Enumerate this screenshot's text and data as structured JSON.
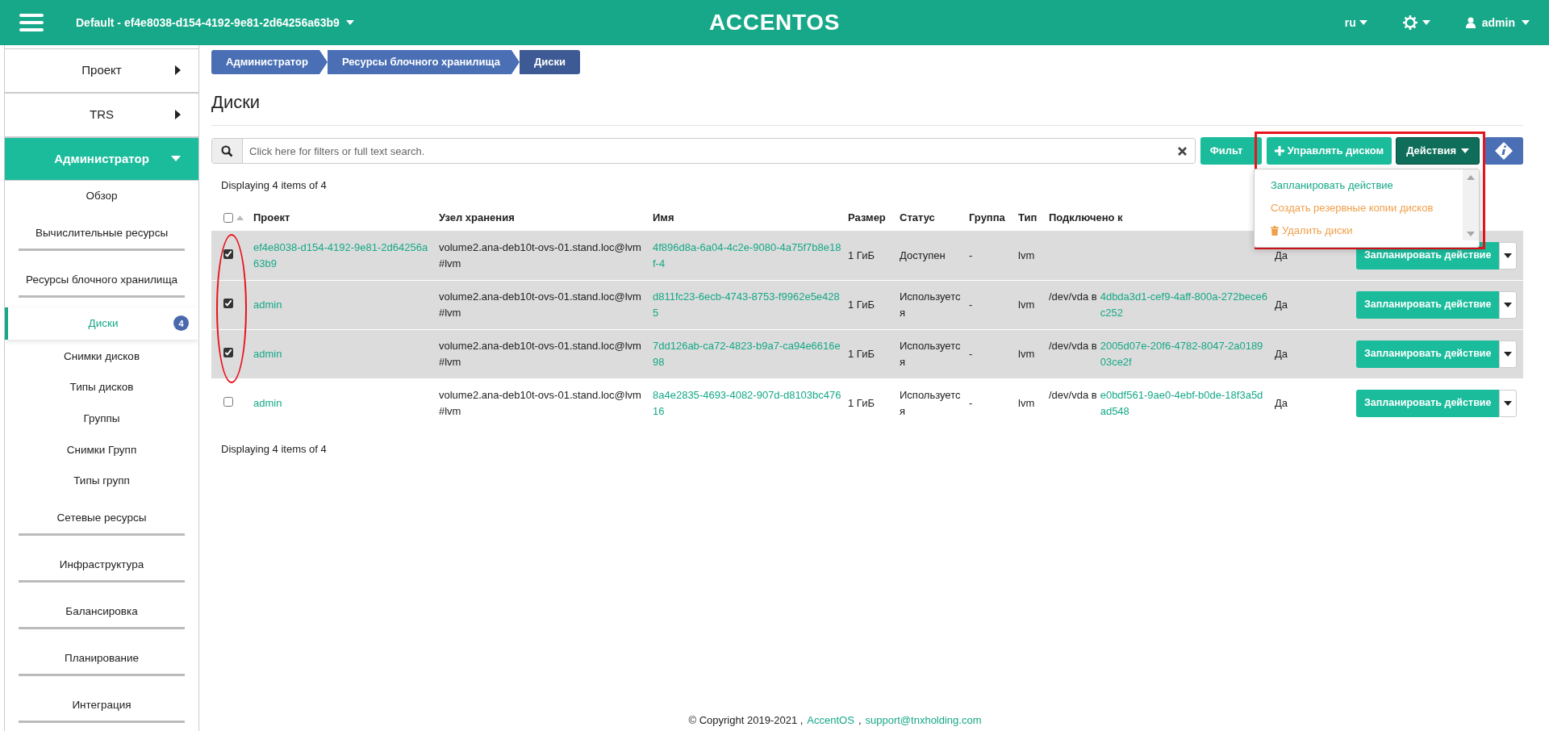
{
  "header": {
    "project": "Default - ef4e8038-d154-4192-9e81-2d64256a63b9",
    "logo": "ACCENTOS",
    "language": "ru",
    "user": "admin"
  },
  "sidebar": {
    "items": [
      {
        "label": "Проект",
        "expanded": false
      },
      {
        "label": "TRS",
        "expanded": false
      },
      {
        "label": "Администратор",
        "expanded": true,
        "children": [
          {
            "kind": "link",
            "label": "Обзор",
            "selected": false
          },
          {
            "kind": "group",
            "label": "Вычислительные ресурсы"
          },
          {
            "kind": "group",
            "label": "Ресурсы блочного хранилища"
          },
          {
            "kind": "link",
            "label": "Диски",
            "selected": true,
            "badge": "4"
          },
          {
            "kind": "link",
            "label": "Снимки дисков",
            "selected": false
          },
          {
            "kind": "link",
            "label": "Типы дисков",
            "selected": false
          },
          {
            "kind": "link",
            "label": "Группы",
            "selected": false
          },
          {
            "kind": "link",
            "label": "Снимки Групп",
            "selected": false
          },
          {
            "kind": "link",
            "label": "Типы групп",
            "selected": false
          },
          {
            "kind": "group",
            "label": "Сетевые ресурсы"
          },
          {
            "kind": "group",
            "label": "Инфраструктура"
          },
          {
            "kind": "group",
            "label": "Балансировка"
          },
          {
            "kind": "group",
            "label": "Планирование"
          },
          {
            "kind": "group",
            "label": "Интеграция"
          }
        ]
      }
    ]
  },
  "breadcrumbs": [
    {
      "label": "Администратор",
      "selected": false
    },
    {
      "label": "Ресурсы блочного хранилища",
      "selected": false
    },
    {
      "label": "Диски",
      "selected": true
    }
  ],
  "title": "Диски",
  "search": {
    "placeholder": "Click here for filters or full text search."
  },
  "buttons": {
    "filter": "Фильт",
    "manage": "Управлять диском",
    "actions": "Действия"
  },
  "actions_menu": [
    {
      "kind": "plain",
      "label": "Запланировать действие"
    },
    {
      "kind": "warning",
      "label": "Создать резервные копии дисков"
    },
    {
      "kind": "delete",
      "label": "Удалить диски"
    }
  ],
  "count_top": "Displaying 4 items of 4",
  "table": {
    "select_all_checked": false,
    "columns": [
      "Проект",
      "Узел хранения",
      "Имя",
      "Размер",
      "Статус",
      "Группа",
      "Тип",
      "Подключено к"
    ],
    "rows": [
      {
        "checked": true,
        "project": "ef4e8038-d154-4192-9e81-2d64256a63b9",
        "host": "volume2.ana-deb10t-ovs-01.stand.loc@lvm#lvm",
        "name": "4f896d8a-6a04-4c2e-9080-4a75f7b8e18f-4",
        "size": "1 ГиБ",
        "status": "Доступен",
        "group": "-",
        "type": "lvm",
        "column_9": "Да",
        "action": "Запланировать действие"
      },
      {
        "checked": true,
        "project": "admin",
        "host": "volume2.ana-deb10t-ovs-01.stand.loc@lvm#lvm",
        "name": "d811fc23-6ecb-4743-8753-f9962e5e4285",
        "size": "1 ГиБ",
        "status": "Используется",
        "group": "-",
        "type": "lvm",
        "attached": {
          "prefix": "/dev/vda в",
          "link": "4dbda3d1-cef9-4aff-800a-272bece6c252"
        },
        "column_9": "Да",
        "action": "Запланировать действие"
      },
      {
        "checked": true,
        "project": "admin",
        "host": "volume2.ana-deb10t-ovs-01.stand.loc@lvm#lvm",
        "name": "7dd126ab-ca72-4823-b9a7-ca94e6616e98",
        "size": "1 ГиБ",
        "status": "Используется",
        "group": "-",
        "type": "lvm",
        "attached": {
          "prefix": "/dev/vda в",
          "link": "2005d07e-20f6-4782-8047-2a018903ce2f"
        },
        "column_9": "Да",
        "action": "Запланировать действие"
      },
      {
        "checked": false,
        "project": "admin",
        "host": "volume2.ana-deb10t-ovs-01.stand.loc@lvm#lvm",
        "name": "8a4e2835-4693-4082-907d-d8103bc47616",
        "size": "1 ГиБ",
        "status": "Используется",
        "group": "-",
        "type": "lvm",
        "attached": {
          "prefix": "/dev/vda в",
          "link": "e0bdf561-9ae0-4ebf-b0de-18f3a5dad548"
        },
        "column_9": "Да",
        "action": "Запланировать действие"
      }
    ]
  },
  "count_bottom": "Displaying 4 items of 4",
  "footer": [
    {
      "kind": "text",
      "text": "© Copyright 2019-2021 ,"
    },
    {
      "kind": "link",
      "text": "AccentOS"
    },
    {
      "kind": "text",
      "text": ","
    },
    {
      "kind": "link",
      "text": "support@tnxholding.com"
    }
  ]
}
